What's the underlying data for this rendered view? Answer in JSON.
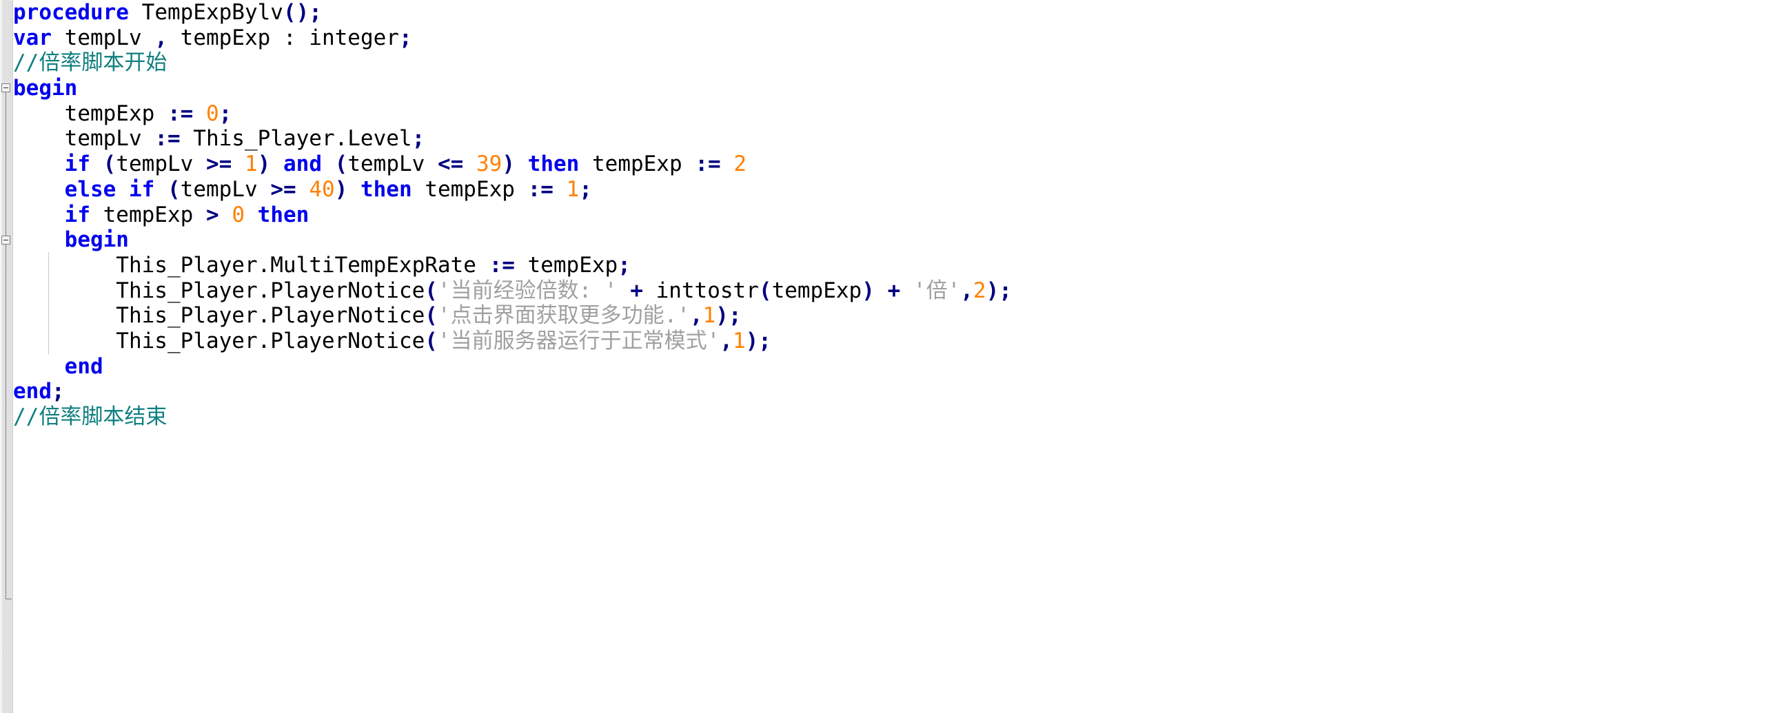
{
  "editor": {
    "language": "Pascal",
    "procedure_name": "TempExpBylv",
    "colors": {
      "keyword": "#0000ee",
      "identifier": "#000000",
      "number": "#ff8000",
      "comment": "#107f7f",
      "string": "#a0a0a0",
      "punctuation": "#000080",
      "background": "#ffffff",
      "gutter": "#e9e9e9"
    }
  },
  "gutter": {
    "fold_markers": [
      {
        "name": "fold-begin-outer",
        "state": "expanded",
        "glyph": "minus-box"
      },
      {
        "name": "fold-begin-inner",
        "state": "expanded",
        "glyph": "minus-box"
      }
    ]
  },
  "code": {
    "lines": [
      {
        "n": 1,
        "tokens": [
          {
            "t": "kw",
            "v": "procedure"
          },
          {
            "t": "plain",
            "v": " "
          },
          {
            "t": "id",
            "v": "TempExpBylv"
          },
          {
            "t": "pn",
            "v": "();"
          }
        ]
      },
      {
        "n": 2,
        "tokens": [
          {
            "t": "kw",
            "v": "var"
          },
          {
            "t": "plain",
            "v": " "
          },
          {
            "t": "id",
            "v": "tempLv "
          },
          {
            "t": "pn",
            "v": ","
          },
          {
            "t": "id",
            "v": " tempExp : integer"
          },
          {
            "t": "pn",
            "v": ";"
          }
        ]
      },
      {
        "n": 3,
        "tokens": [
          {
            "t": "cm",
            "v": "//倍率脚本开始"
          }
        ]
      },
      {
        "n": 4,
        "tokens": [
          {
            "t": "kw",
            "v": "begin"
          }
        ]
      },
      {
        "n": 5,
        "tokens": [
          {
            "t": "id",
            "v": "    tempExp "
          },
          {
            "t": "op",
            "v": ":="
          },
          {
            "t": "plain",
            "v": " "
          },
          {
            "t": "num",
            "v": "0"
          },
          {
            "t": "pn",
            "v": ";"
          }
        ]
      },
      {
        "n": 6,
        "tokens": [
          {
            "t": "id",
            "v": "    tempLv "
          },
          {
            "t": "op",
            "v": ":="
          },
          {
            "t": "id",
            "v": " This_Player.Level"
          },
          {
            "t": "pn",
            "v": ";"
          }
        ]
      },
      {
        "n": 7,
        "tokens": [
          {
            "t": "plain",
            "v": "    "
          },
          {
            "t": "kw",
            "v": "if"
          },
          {
            "t": "plain",
            "v": " "
          },
          {
            "t": "pn",
            "v": "("
          },
          {
            "t": "id",
            "v": "tempLv "
          },
          {
            "t": "op",
            "v": ">="
          },
          {
            "t": "plain",
            "v": " "
          },
          {
            "t": "num",
            "v": "1"
          },
          {
            "t": "pn",
            "v": ")"
          },
          {
            "t": "plain",
            "v": " "
          },
          {
            "t": "kw",
            "v": "and"
          },
          {
            "t": "plain",
            "v": " "
          },
          {
            "t": "pn",
            "v": "("
          },
          {
            "t": "id",
            "v": "tempLv "
          },
          {
            "t": "op",
            "v": "<="
          },
          {
            "t": "plain",
            "v": " "
          },
          {
            "t": "num",
            "v": "39"
          },
          {
            "t": "pn",
            "v": ")"
          },
          {
            "t": "plain",
            "v": " "
          },
          {
            "t": "kw",
            "v": "then"
          },
          {
            "t": "id",
            "v": " tempExp "
          },
          {
            "t": "op",
            "v": ":="
          },
          {
            "t": "plain",
            "v": " "
          },
          {
            "t": "num",
            "v": "2"
          }
        ]
      },
      {
        "n": 8,
        "tokens": [
          {
            "t": "plain",
            "v": "    "
          },
          {
            "t": "kw",
            "v": "else if"
          },
          {
            "t": "plain",
            "v": " "
          },
          {
            "t": "pn",
            "v": "("
          },
          {
            "t": "id",
            "v": "tempLv "
          },
          {
            "t": "op",
            "v": ">="
          },
          {
            "t": "plain",
            "v": " "
          },
          {
            "t": "num",
            "v": "40"
          },
          {
            "t": "pn",
            "v": ")"
          },
          {
            "t": "plain",
            "v": " "
          },
          {
            "t": "kw",
            "v": "then"
          },
          {
            "t": "id",
            "v": " tempExp "
          },
          {
            "t": "op",
            "v": ":="
          },
          {
            "t": "plain",
            "v": " "
          },
          {
            "t": "num",
            "v": "1"
          },
          {
            "t": "pn",
            "v": ";"
          }
        ]
      },
      {
        "n": 9,
        "tokens": [
          {
            "t": "plain",
            "v": "    "
          },
          {
            "t": "kw",
            "v": "if"
          },
          {
            "t": "id",
            "v": " tempExp "
          },
          {
            "t": "op",
            "v": ">"
          },
          {
            "t": "plain",
            "v": " "
          },
          {
            "t": "num",
            "v": "0"
          },
          {
            "t": "plain",
            "v": " "
          },
          {
            "t": "kw",
            "v": "then"
          }
        ]
      },
      {
        "n": 10,
        "tokens": [
          {
            "t": "plain",
            "v": "    "
          },
          {
            "t": "kw",
            "v": "begin"
          }
        ]
      },
      {
        "n": 11,
        "tokens": [
          {
            "t": "id",
            "v": "        This_Player.MultiTempExpRate "
          },
          {
            "t": "op",
            "v": ":="
          },
          {
            "t": "id",
            "v": " tempExp"
          },
          {
            "t": "pn",
            "v": ";"
          }
        ]
      },
      {
        "n": 12,
        "tokens": [
          {
            "t": "id",
            "v": "        This_Player.PlayerNotice"
          },
          {
            "t": "pn",
            "v": "("
          },
          {
            "t": "str",
            "v": "'当前经验倍数: '"
          },
          {
            "t": "plain",
            "v": " "
          },
          {
            "t": "op",
            "v": "+"
          },
          {
            "t": "id",
            "v": " inttostr"
          },
          {
            "t": "pn",
            "v": "("
          },
          {
            "t": "id",
            "v": "tempExp"
          },
          {
            "t": "pn",
            "v": ")"
          },
          {
            "t": "plain",
            "v": " "
          },
          {
            "t": "op",
            "v": "+"
          },
          {
            "t": "plain",
            "v": " "
          },
          {
            "t": "str",
            "v": "'倍'"
          },
          {
            "t": "pn",
            "v": ","
          },
          {
            "t": "num",
            "v": "2"
          },
          {
            "t": "pn",
            "v": ");"
          }
        ]
      },
      {
        "n": 13,
        "tokens": [
          {
            "t": "id",
            "v": "        This_Player.PlayerNotice"
          },
          {
            "t": "pn",
            "v": "("
          },
          {
            "t": "str",
            "v": "'点击界面获取更多功能.'"
          },
          {
            "t": "pn",
            "v": ","
          },
          {
            "t": "num",
            "v": "1"
          },
          {
            "t": "pn",
            "v": ");"
          }
        ]
      },
      {
        "n": 14,
        "tokens": [
          {
            "t": "id",
            "v": "        This_Player.PlayerNotice"
          },
          {
            "t": "pn",
            "v": "("
          },
          {
            "t": "str",
            "v": "'当前服务器运行于正常模式'"
          },
          {
            "t": "pn",
            "v": ","
          },
          {
            "t": "num",
            "v": "1"
          },
          {
            "t": "pn",
            "v": ");"
          }
        ]
      },
      {
        "n": 15,
        "tokens": [
          {
            "t": "plain",
            "v": "    "
          },
          {
            "t": "kw",
            "v": "end"
          }
        ]
      },
      {
        "n": 16,
        "tokens": [
          {
            "t": "kw",
            "v": "end"
          },
          {
            "t": "pn",
            "v": ";"
          }
        ]
      },
      {
        "n": 17,
        "tokens": [
          {
            "t": "cm",
            "v": "//倍率脚本结束"
          }
        ]
      }
    ]
  }
}
